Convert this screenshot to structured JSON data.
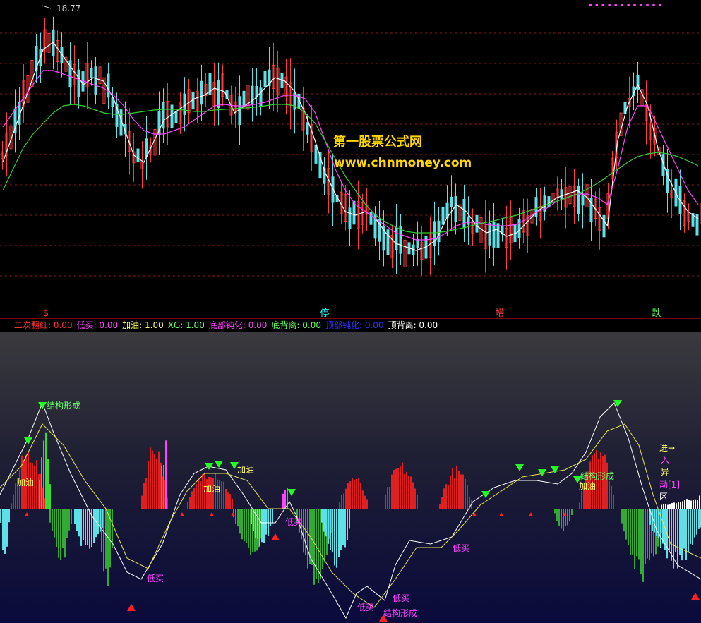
{
  "watermark": {
    "line1": "第一股票公式网",
    "line2": "www.chnmoney.com"
  },
  "toolbar": {
    "dots": "▪ ▪ ▪ ▪ ▪   ▪ ▪ ▪ ▪ ▪ ▪ ▪"
  },
  "info_bar": [
    {
      "label": "二次翻红:",
      "value": "0.00",
      "color": "#ff3030"
    },
    {
      "label": "低买:",
      "value": "0.00",
      "color": "#ff44ff"
    },
    {
      "label": "加油:",
      "value": "1.00",
      "color": "#ffff66"
    },
    {
      "label": "XG:",
      "value": "1.00",
      "color": "#66ff66"
    },
    {
      "label": "底部钝化:",
      "value": "0.00",
      "color": "#ff44ff"
    },
    {
      "label": "底背离:",
      "value": "0.00",
      "color": "#66ff66"
    },
    {
      "label": "顶部钝化:",
      "value": "0.00",
      "color": "#3030ff"
    },
    {
      "label": "顶背离:",
      "value": "0.00",
      "color": "#ffffff"
    }
  ],
  "chart_data": [
    {
      "type": "candlestick",
      "high_label": "18.77",
      "gridlines": true,
      "bottom_markers": [
        {
          "text": "$",
          "color": "#ff3030"
        },
        {
          "text": "停",
          "color": "#22ffff"
        },
        {
          "text": "增",
          "color": "#ff4040"
        },
        {
          "text": "跌",
          "color": "#66ff66"
        }
      ],
      "series": [
        {
          "name": "",
          "color": "#ffffff",
          "values": [
            230,
            190,
            150,
            110,
            70,
            60,
            80,
            100,
            120,
            110,
            115,
            140,
            180,
            220,
            230,
            200,
            170,
            160,
            150,
            140,
            135,
            125,
            130,
            160,
            150,
            140,
            125,
            110,
            115,
            130,
            160,
            200,
            245,
            275,
            300,
            305,
            300,
            310,
            330,
            345,
            350,
            355,
            350,
            340,
            310,
            290,
            300,
            320,
            330,
            325,
            335,
            330,
            315,
            300,
            290,
            280,
            275,
            270,
            280,
            300,
            320,
            200,
            150,
            120,
            150,
            210,
            250,
            280,
            300,
            310
          ]
        },
        {
          "name": "",
          "color": "#ff44ff",
          "values": [
            180,
            160,
            140,
            120,
            100,
            100,
            105,
            110,
            115,
            120,
            125,
            135,
            150,
            170,
            185,
            190,
            190,
            185,
            180,
            170,
            160,
            150,
            148,
            150,
            150,
            148,
            145,
            140,
            135,
            135,
            140,
            160,
            200,
            240,
            270,
            290,
            300,
            310,
            320,
            330,
            335,
            340,
            340,
            338,
            330,
            320,
            315,
            315,
            318,
            320,
            320,
            318,
            310,
            300,
            295,
            285,
            280,
            275,
            275,
            280,
            290,
            240,
            180,
            150,
            150,
            180,
            210,
            240,
            270,
            290
          ]
        },
        {
          "name": "",
          "color": "#33cc33",
          "values": [
            270,
            240,
            210,
            190,
            175,
            160,
            150,
            148,
            150,
            155,
            160,
            162,
            162,
            160,
            158,
            156,
            155,
            155,
            156,
            158,
            158,
            156,
            155,
            154,
            153,
            152,
            150,
            148,
            148,
            150,
            160,
            175,
            200,
            225,
            250,
            270,
            290,
            305,
            315,
            322,
            328,
            330,
            330,
            330,
            328,
            325,
            322,
            318,
            315,
            312,
            308,
            305,
            300,
            295,
            290,
            285,
            280,
            275,
            268,
            260,
            250,
            240,
            230,
            222,
            218,
            216,
            218,
            222,
            228,
            235
          ]
        }
      ]
    },
    {
      "type": "bar",
      "annotations": [
        {
          "text": "结构形成",
          "color": "#66ff66"
        },
        {
          "text": "加油",
          "color": "#ffff66"
        },
        {
          "text": "加油",
          "color": "#ffff66"
        },
        {
          "text": "加油",
          "color": "#ffff66"
        },
        {
          "text": "加油",
          "color": "#ffff66"
        },
        {
          "text": "低买",
          "color": "#ff44ff"
        },
        {
          "text": "低买",
          "color": "#ff44ff"
        },
        {
          "text": "低买",
          "color": "#ff44ff"
        },
        {
          "text": "低买",
          "color": "#ff44ff"
        },
        {
          "text": "低买",
          "color": "#ff44ff"
        },
        {
          "text": "结构形成",
          "color": "#ff44ff"
        },
        {
          "text": "结构形成",
          "color": "#66ff66"
        },
        {
          "text": "进→",
          "color": "#ffff66"
        },
        {
          "text": "入",
          "color": "#ff44ff"
        },
        {
          "text": "异",
          "color": "#ffff66"
        },
        {
          "text": "动[1]",
          "color": "#ff44ff"
        },
        {
          "text": "区",
          "color": "#ffffff"
        }
      ]
    }
  ]
}
